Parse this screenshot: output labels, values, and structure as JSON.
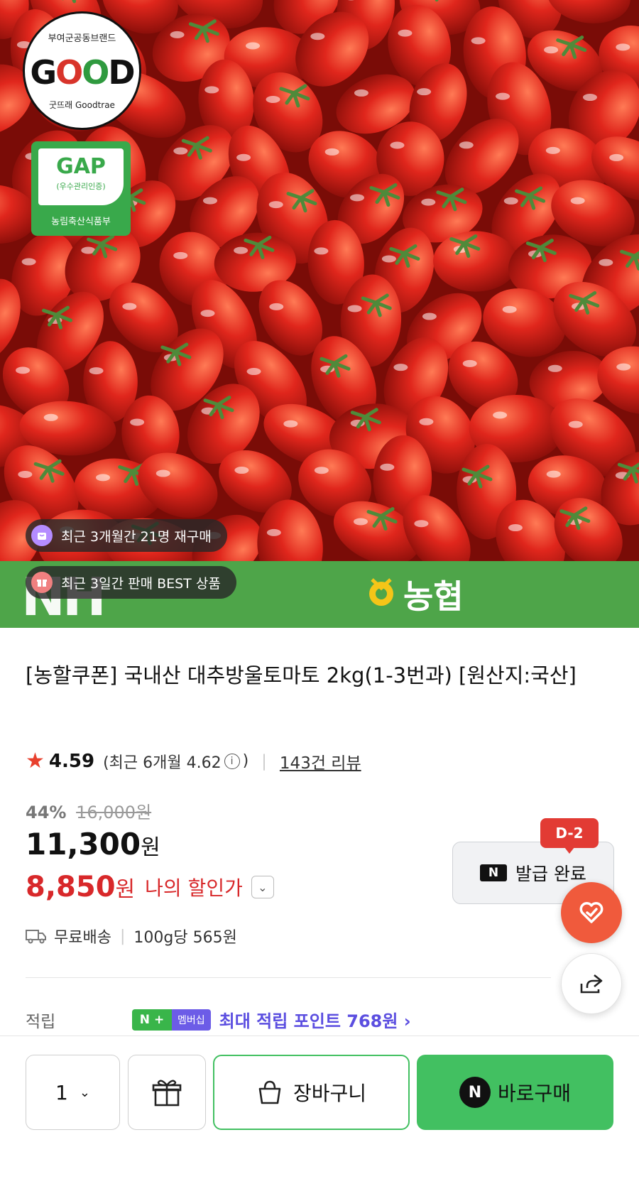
{
  "hero": {
    "good_badge": {
      "top_text": "부여군공동브랜드",
      "logo": "GOOD",
      "bottom_text": "굿뜨래 Goodtrae"
    },
    "gap_badge": {
      "title": "GAP",
      "subtitle": "(우수관리인증)",
      "ministry": "농림축산식품부"
    },
    "chips": [
      {
        "icon": "purple-bag-icon",
        "text": "최근 3개월간 21명 재구매"
      },
      {
        "icon": "gift-box-icon",
        "text": "최근 3일간 판매 BEST 상품"
      }
    ],
    "banner": {
      "letters": "NH",
      "word": "농협"
    }
  },
  "product": {
    "title": "[농할쿠폰] 국내산 대추방울토마토 2kg(1-3번과) [원산지:국산]",
    "rating": "4.59",
    "recent_rating_prefix": "(최근 6개월 4.62",
    "recent_rating_suffix": ")",
    "review_count": "143건 리뷰",
    "discount_rate": "44%",
    "original_price": "16,000원",
    "sale_price": "11,300",
    "won": "원",
    "my_price": "8,850",
    "my_price_label": "나의 할인가",
    "delivery": "무료배송",
    "unit_price": "100g당 565원"
  },
  "coupon": {
    "dday": "D-2",
    "label": "발급 완료",
    "n_icon": "N"
  },
  "points": {
    "label": "적립",
    "badge_n": "N +",
    "badge_member": "멤버십",
    "text": "최대 적립 포인트 768원 ›"
  },
  "bottom": {
    "quantity": "1",
    "cart_label": "장바구니",
    "buy_label": "바로구매",
    "buy_icon": "N"
  },
  "colors": {
    "accent_red": "#d8282a",
    "naver_green": "#42c061",
    "nh_green": "#4ea549",
    "membership_purple": "#5b4ee0"
  }
}
